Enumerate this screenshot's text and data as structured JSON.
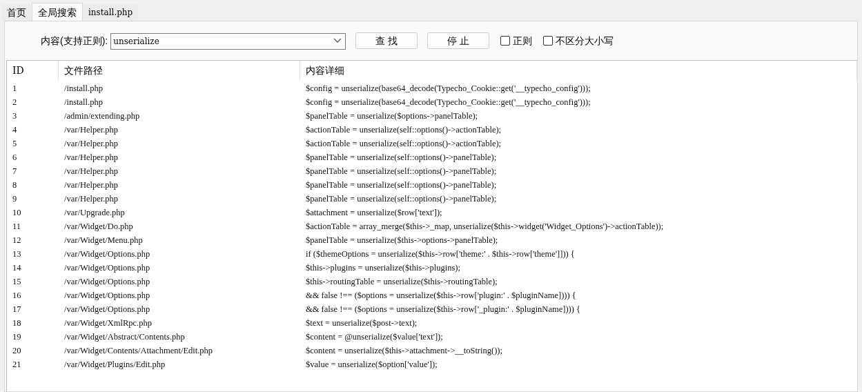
{
  "tabs": [
    {
      "label": "首页",
      "selected": false
    },
    {
      "label": "全局搜索",
      "selected": true
    },
    {
      "label": "install.php",
      "selected": false
    }
  ],
  "search": {
    "label": "内容(支持正则):",
    "value": "unserialize",
    "buttons": [
      "查 找",
      "停 止"
    ],
    "options": [
      {
        "label": "正则",
        "checked": false
      },
      {
        "label": "不区分大小写",
        "checked": false
      }
    ]
  },
  "table": {
    "columns": [
      "ID",
      "文件路径",
      "内容详细"
    ],
    "rows": [
      [
        "1",
        "/install.php",
        "$config = unserialize(base64_decode(Typecho_Cookie::get('__typecho_config')));"
      ],
      [
        "2",
        "/install.php",
        "$config = unserialize(base64_decode(Typecho_Cookie::get('__typecho_config')));"
      ],
      [
        "3",
        "/admin/extending.php",
        "$panelTable = unserialize($options->panelTable);"
      ],
      [
        "4",
        "/var/Helper.php",
        "$actionTable = unserialize(self::options()->actionTable);"
      ],
      [
        "5",
        "/var/Helper.php",
        "$actionTable = unserialize(self::options()->actionTable);"
      ],
      [
        "6",
        "/var/Helper.php",
        "$panelTable = unserialize(self::options()->panelTable);"
      ],
      [
        "7",
        "/var/Helper.php",
        "$panelTable = unserialize(self::options()->panelTable);"
      ],
      [
        "8",
        "/var/Helper.php",
        "$panelTable = unserialize(self::options()->panelTable);"
      ],
      [
        "9",
        "/var/Helper.php",
        "$panelTable = unserialize(self::options()->panelTable);"
      ],
      [
        "10",
        "/var/Upgrade.php",
        "$attachment = unserialize($row['text']);"
      ],
      [
        "11",
        "/var/Widget/Do.php",
        "$actionTable = array_merge($this->_map, unserialize($this->widget('Widget_Options')->actionTable));"
      ],
      [
        "12",
        "/var/Widget/Menu.php",
        "$panelTable = unserialize($this->options->panelTable);"
      ],
      [
        "13",
        "/var/Widget/Options.php",
        "if ($themeOptions = unserialize($this->row['theme:' . $this->row['theme']])) {"
      ],
      [
        "14",
        "/var/Widget/Options.php",
        "$this->plugins = unserialize($this->plugins);"
      ],
      [
        "15",
        "/var/Widget/Options.php",
        "$this->routingTable = unserialize($this->routingTable);"
      ],
      [
        "16",
        "/var/Widget/Options.php",
        "&& false !== ($options = unserialize($this->row['plugin:' . $pluginName]))) {"
      ],
      [
        "17",
        "/var/Widget/Options.php",
        "&& false !== ($options = unserialize($this->row['_plugin:' . $pluginName]))) {"
      ],
      [
        "18",
        "/var/Widget/XmlRpc.php",
        "$text = unserialize($post->text);"
      ],
      [
        "19",
        "/var/Widget/Abstract/Contents.php",
        "$content = @unserialize($value['text']);"
      ],
      [
        "20",
        "/var/Widget/Contents/Attachment/Edit.php",
        "$content = unserialize($this->attachment->__toString());"
      ],
      [
        "21",
        "/var/Widget/Plugins/Edit.php",
        "$value = unserialize($option['value']);"
      ]
    ]
  }
}
